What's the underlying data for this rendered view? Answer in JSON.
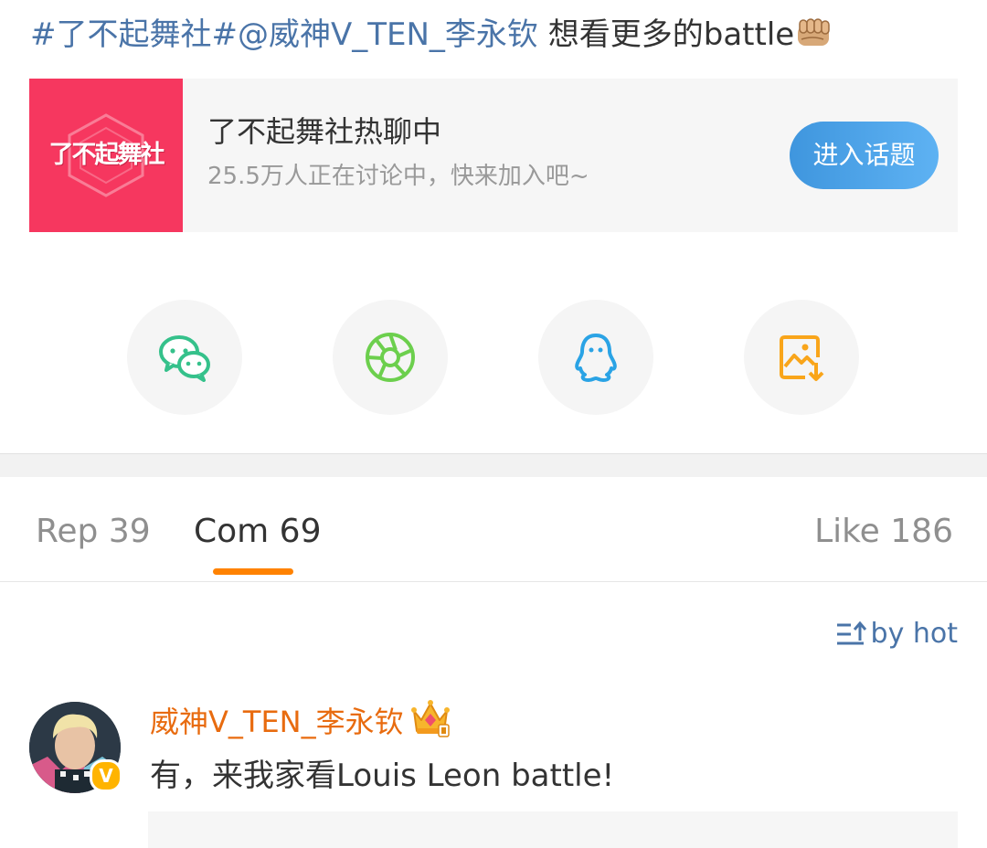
{
  "post": {
    "hashtag": "#了不起舞社#",
    "mention": "@威神V_TEN_李永钦",
    "text": " 想看更多的battle",
    "emoji": "fist-bump-emoji"
  },
  "topic": {
    "thumb_text": "了不起舞社",
    "title": "了不起舞社热聊中",
    "subtitle": "25.5万人正在讨论中，快来加入吧~",
    "button_label": "进入话题",
    "accent": "#f6375f",
    "button_color": "#4aa3e8"
  },
  "share": {
    "items": [
      {
        "icon": "wechat-icon",
        "color": "#35c18b"
      },
      {
        "icon": "moments-icon",
        "color": "#6ccf4d"
      },
      {
        "icon": "qq-icon",
        "color": "#2aa3e5"
      },
      {
        "icon": "save-image-icon",
        "color": "#f9a51a"
      }
    ]
  },
  "tabs": {
    "reposts": "Rep 39",
    "comments": "Com 69",
    "likes": "Like 186",
    "active": "comments",
    "indicator_color": "#ff8200"
  },
  "sort": {
    "label": "by hot"
  },
  "comments": [
    {
      "username": "威神V_TEN_李永钦",
      "verified": "V",
      "badge": "crown-badge-icon",
      "text": "有，来我家看Louis Leon battle!",
      "name_color": "#e86b0f"
    }
  ],
  "colors": {
    "link": "#4a74a8",
    "text": "#333333",
    "muted": "#999999"
  }
}
